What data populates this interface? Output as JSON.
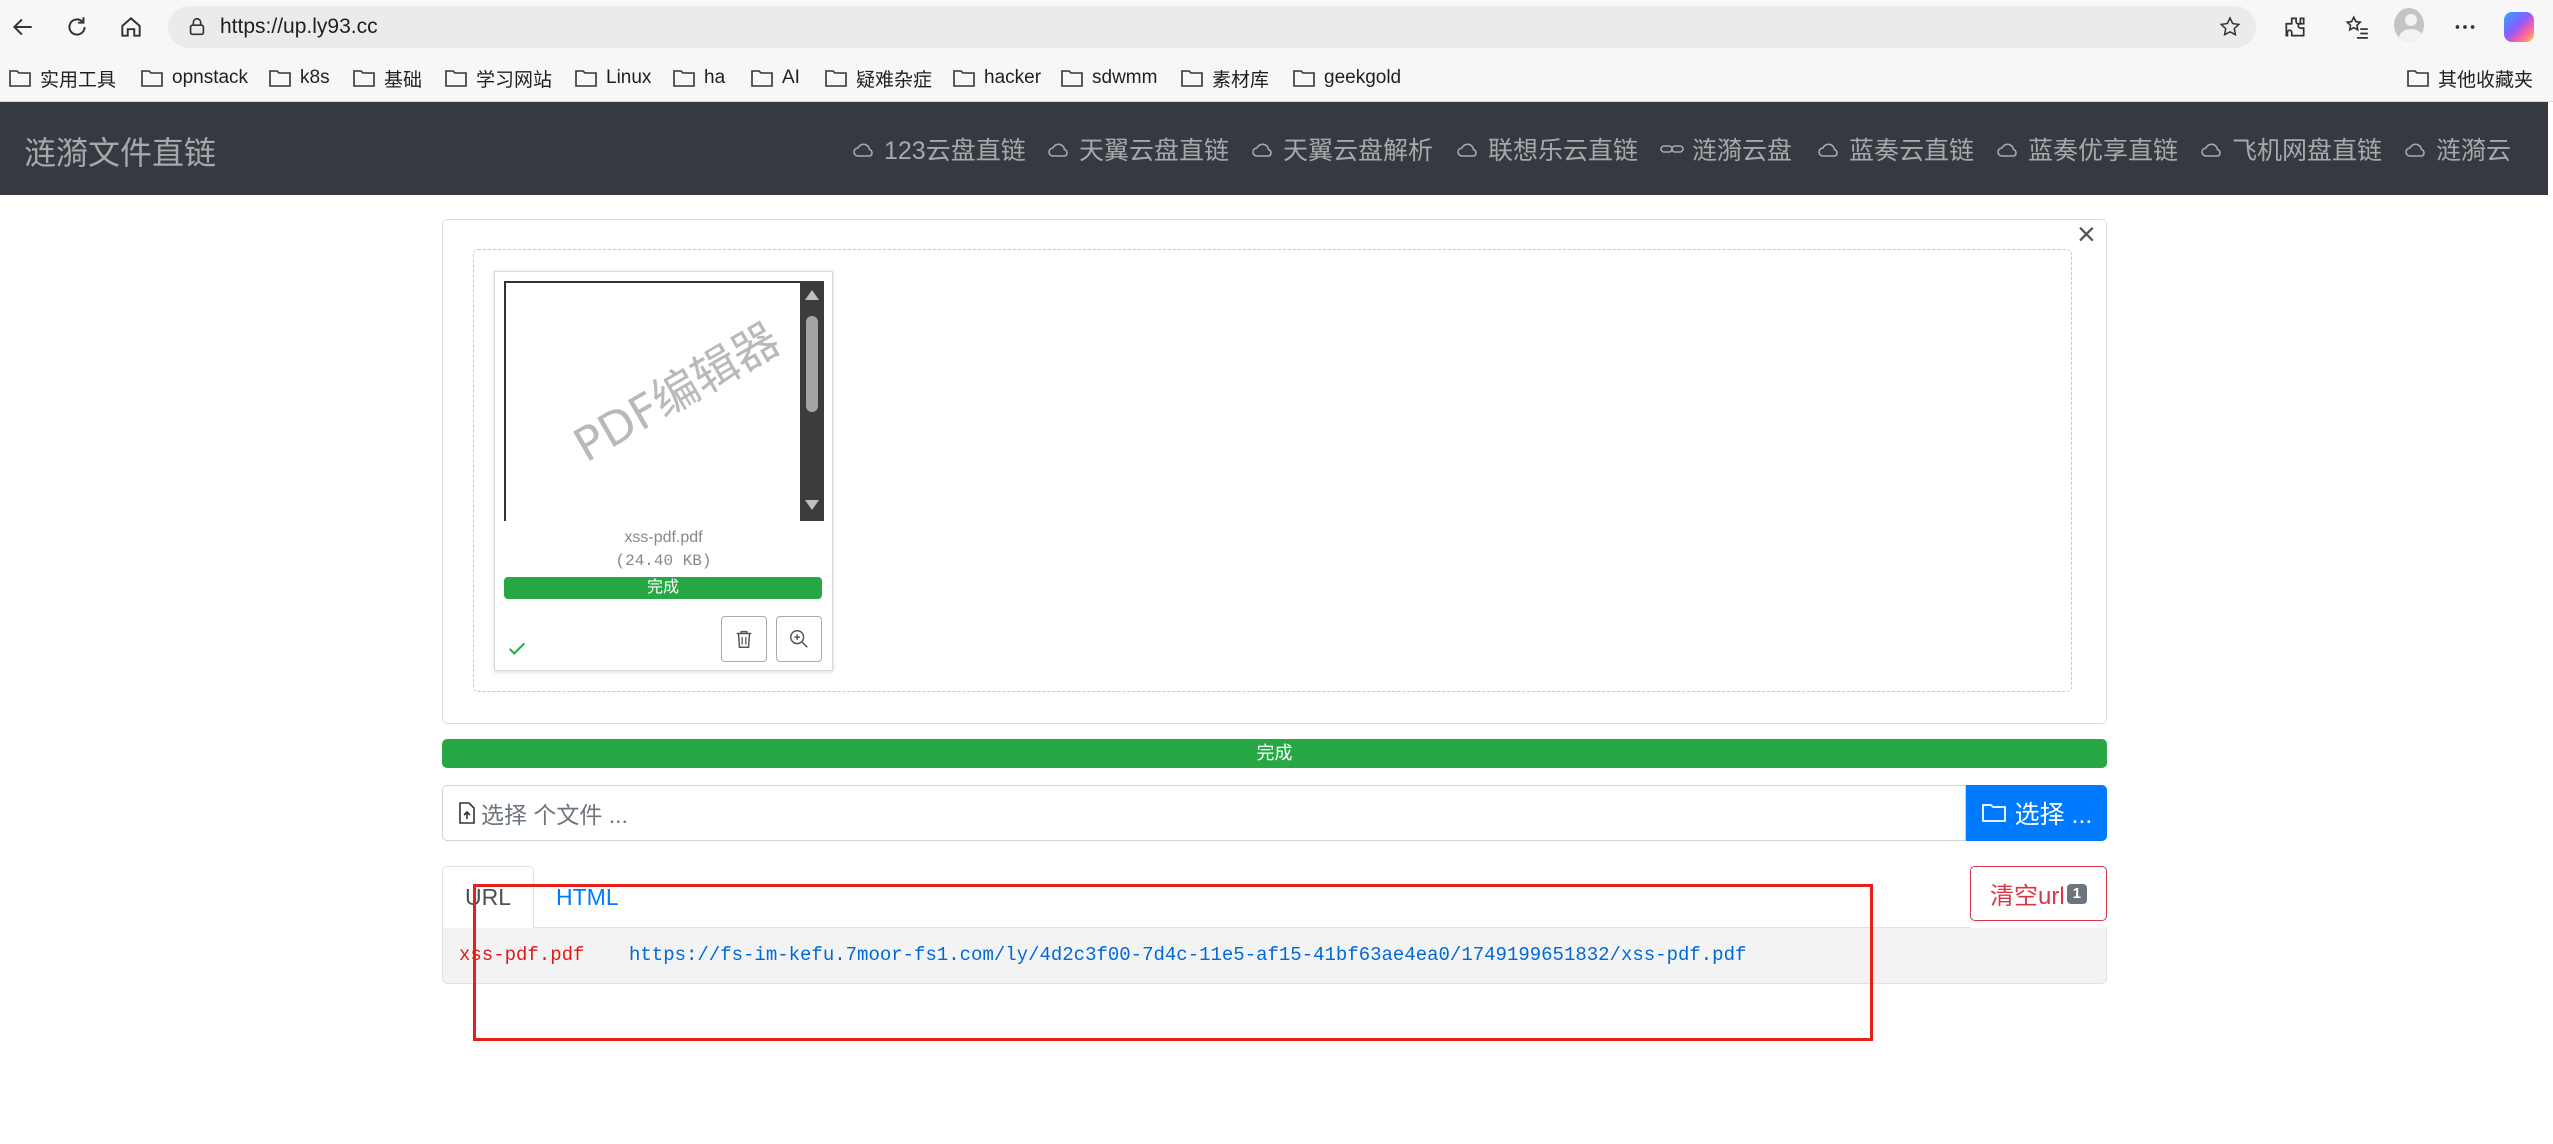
{
  "browser": {
    "url": "https://up.ly93.cc",
    "bookmarks": [
      {
        "label": "实用工具"
      },
      {
        "label": "opnstack"
      },
      {
        "label": "k8s"
      },
      {
        "label": "基础"
      },
      {
        "label": "学习网站"
      },
      {
        "label": "Linux"
      },
      {
        "label": "ha"
      },
      {
        "label": "AI"
      },
      {
        "label": "疑难杂症"
      },
      {
        "label": "hacker"
      },
      {
        "label": "sdwmm"
      },
      {
        "label": "素材库"
      },
      {
        "label": "geekgold"
      }
    ],
    "other_bookmarks": "其他收藏夹"
  },
  "navbar": {
    "brand": "涟漪文件直链",
    "links": [
      {
        "label": "123云盘直链",
        "icon": "cloud-icon"
      },
      {
        "label": "天翼云盘直链",
        "icon": "cloud-icon"
      },
      {
        "label": "天翼云盘解析",
        "icon": "cloud-icon"
      },
      {
        "label": "联想乐云直链",
        "icon": "cloud-icon"
      },
      {
        "label": "涟漪云盘",
        "icon": "link-icon"
      },
      {
        "label": "蓝奏云直链",
        "icon": "cloud-icon"
      },
      {
        "label": "蓝奏优享直链",
        "icon": "cloud-icon"
      },
      {
        "label": "飞机网盘直链",
        "icon": "cloud-icon"
      },
      {
        "label": "涟漪云",
        "icon": "cloud-icon"
      }
    ]
  },
  "upload": {
    "close": "×",
    "file": {
      "preview_watermark": "PDF编辑器",
      "name": "xss-pdf.pdf",
      "size": "(24.40 KB)",
      "status": "完成",
      "progress": 1.0
    },
    "overall_status": "完成",
    "overall_progress": 1.0,
    "input_placeholder": "选择 个文件 ...",
    "browse_label": "选择 ..."
  },
  "results": {
    "tabs": [
      {
        "label": "URL",
        "active": true
      },
      {
        "label": "HTML",
        "active": false
      }
    ],
    "clear_label": "清空url",
    "clear_count": "1",
    "rows": [
      {
        "name": "xss-pdf.pdf",
        "link": "https://fs-im-kefu.7moor-fs1.com/ly/4d2c3f00-7d4c-11e5-af15-41bf63ae4ea0/1749199651832/xss-pdf.pdf"
      }
    ]
  },
  "colors": {
    "navbar_bg": "#343a40",
    "success": "#28a745",
    "primary": "#007bff",
    "danger": "#dc3545",
    "annotation": "#e8201d"
  }
}
